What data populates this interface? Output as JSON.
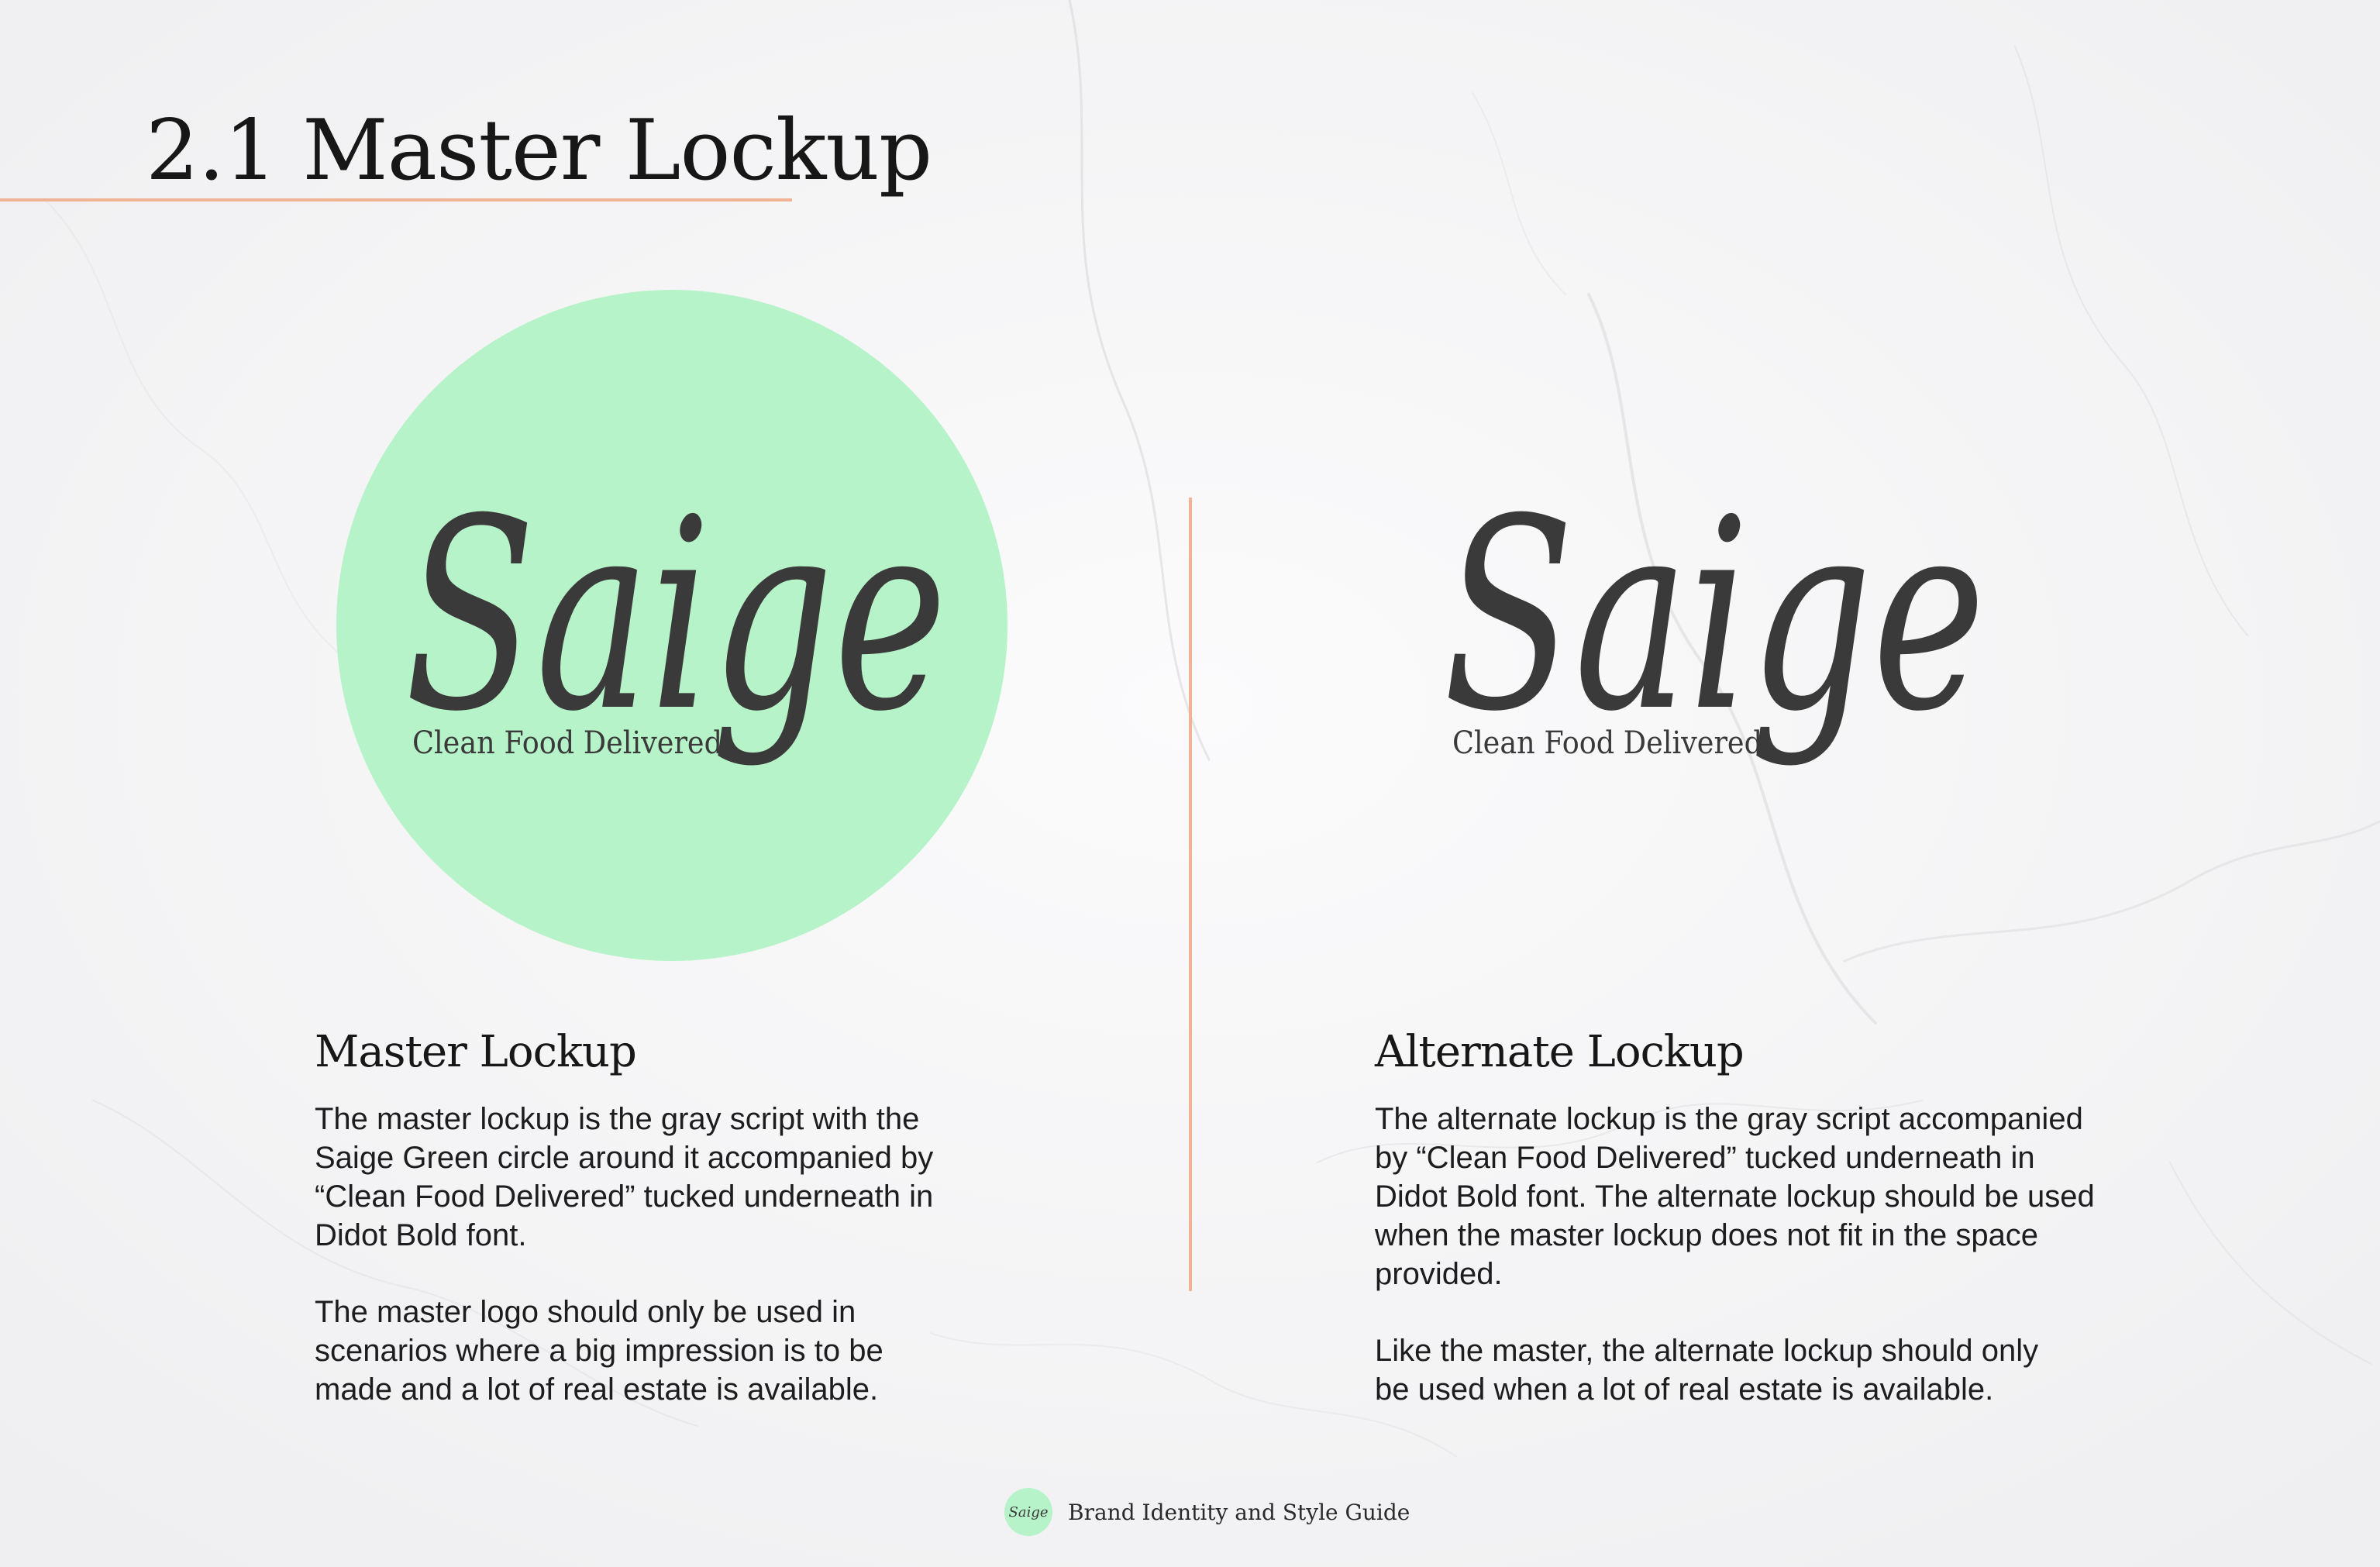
{
  "heading": {
    "title": "2.1 Master Lockup"
  },
  "colors": {
    "saige_green": "#b6f3c8",
    "accent_rule": "#f2b395",
    "logo_gray": "#3a3a3a",
    "text_dark": "#1d1d1f"
  },
  "master_lockup": {
    "logo_wordmark": "Saige",
    "logo_tagline": "Clean Food Delivered",
    "title": "Master Lockup",
    "paragraphs": [
      "The master lockup is the gray script with the Saige Green circle around it accompanied by “Clean Food Delivered” tucked underneath in Didot Bold font.",
      "The master logo should only be used in scenarios where a big impression is to be made and a lot of real estate is available."
    ]
  },
  "alternate_lockup": {
    "logo_wordmark": "Saige",
    "logo_tagline": "Clean Food Delivered",
    "title": "Alternate Lockup",
    "paragraphs": [
      "The alternate lockup is the gray script accompanied by “Clean Food Delivered” tucked underneath in Didot Bold font. The alternate lockup should be used when the master lockup does not fit in the space provided.",
      "Like the master, the alternate lockup should only be used when a lot of real estate is available."
    ]
  },
  "footer": {
    "badge_wordmark": "Saige",
    "text": "Brand Identity and Style Guide"
  }
}
